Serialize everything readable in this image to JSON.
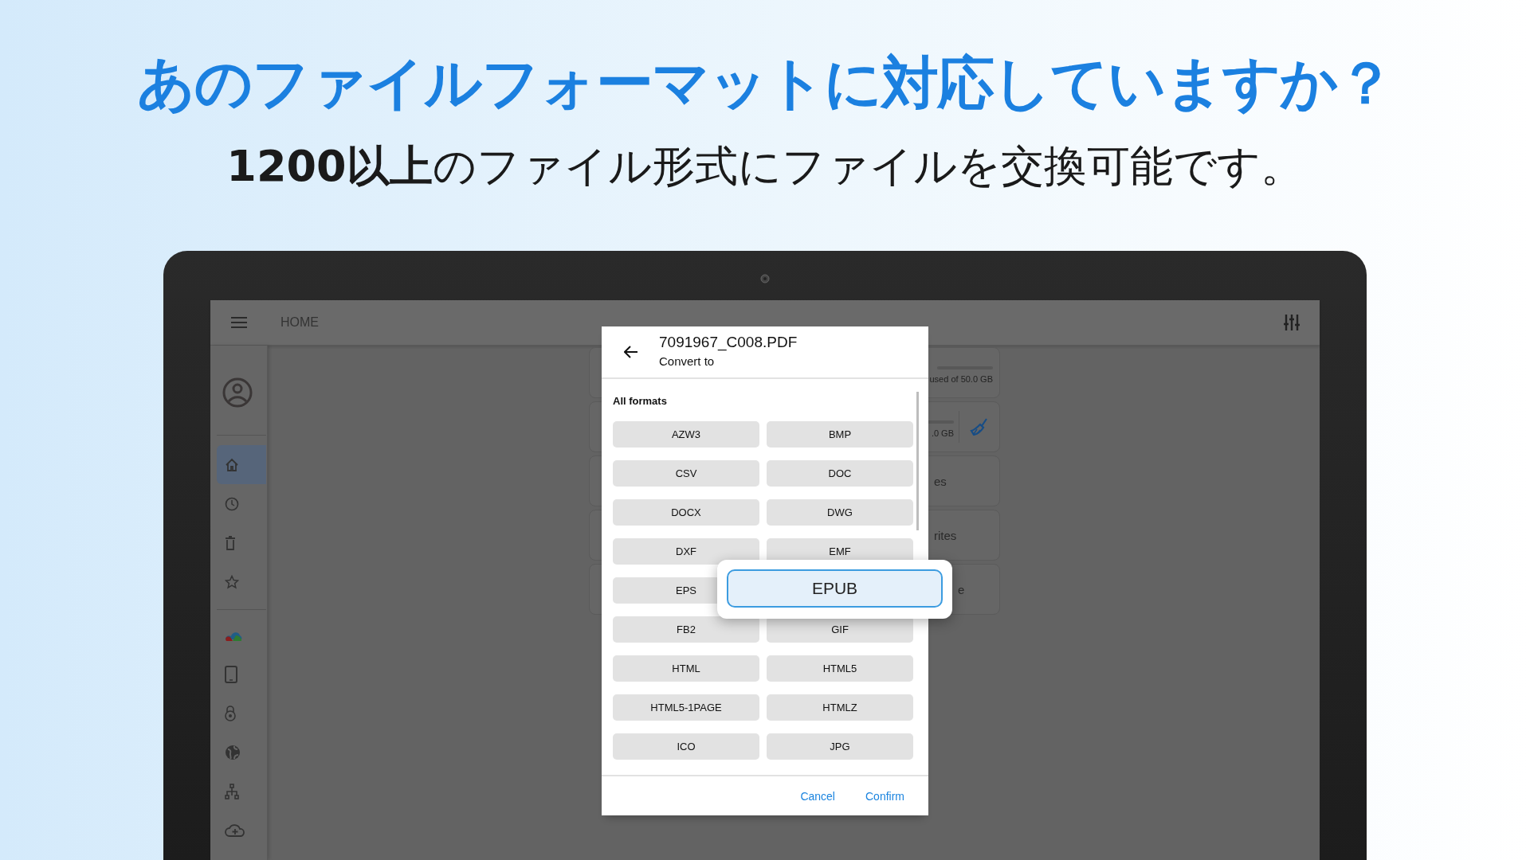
{
  "headline": "あのファイルフォーマットに対応していますか？",
  "subheadline": "**1200以上**のファイル形式にファイルを交換可能です。",
  "app_bar": {
    "title": "HOME"
  },
  "sidebar": {
    "items": [
      {
        "selected": true
      },
      {
        "selected": false
      },
      {
        "selected": false
      },
      {
        "selected": false
      }
    ]
  },
  "cards": [
    {
      "kind": "storage",
      "text": "used of 50.0 GB"
    },
    {
      "kind": "storage_clean",
      "text": ".0 GB"
    },
    {
      "kind": "link",
      "text": "es"
    },
    {
      "kind": "link",
      "text": "rites"
    },
    {
      "kind": "link",
      "text": "e"
    }
  ],
  "dialog": {
    "title": "7091967_C008.PDF",
    "subtitle": "Convert to",
    "section": "All formats",
    "formats": [
      {
        "label": "AZW3",
        "selected": false
      },
      {
        "label": "BMP",
        "selected": false
      },
      {
        "label": "CSV",
        "selected": false
      },
      {
        "label": "DOC",
        "selected": false
      },
      {
        "label": "DOCX",
        "selected": false
      },
      {
        "label": "DWG",
        "selected": false
      },
      {
        "label": "DXF",
        "selected": false
      },
      {
        "label": "EMF",
        "selected": false
      },
      {
        "label": "EPS",
        "selected": false
      },
      {
        "label": "EPUB",
        "selected": true
      },
      {
        "label": "FB2",
        "selected": false
      },
      {
        "label": "GIF",
        "selected": false
      },
      {
        "label": "HTML",
        "selected": false
      },
      {
        "label": "HTML5",
        "selected": false
      },
      {
        "label": "HTML5-1PAGE",
        "selected": false
      },
      {
        "label": "HTMLZ",
        "selected": false
      },
      {
        "label": "ICO",
        "selected": false
      },
      {
        "label": "JPG",
        "selected": false
      }
    ],
    "buttons": [
      "Cancel",
      "Confirm"
    ]
  }
}
